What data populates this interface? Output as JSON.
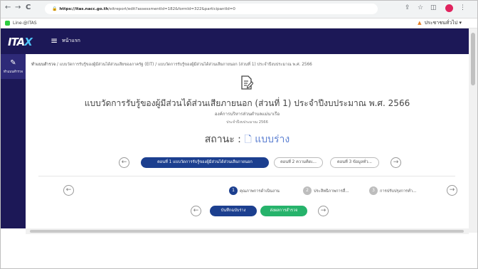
{
  "browser": {
    "url_host": "https://itas.nacc.go.th",
    "url_path": "/eitreport/edit?assessmentId=182&formId=322&participantId=0",
    "nav_back": "←",
    "nav_forward": "→",
    "nav_reload": "C",
    "lock_icon": "🔒",
    "share_icon": "⇪",
    "star_icon": "☆",
    "ext_icon": "◫"
  },
  "bookmark": {
    "label": "Line-@ITAS"
  },
  "user_menu": {
    "label": "ประชาชนทั่วไป ▾",
    "icon": "▲"
  },
  "header": {
    "logo_main": "ITA",
    "logo_accent": "X",
    "menu_icon": "≡",
    "home_label": "หน้าแรก"
  },
  "sidebar": {
    "item_label": "ทำแบบสำรวจ",
    "item_icon": "✎"
  },
  "breadcrumb": {
    "item1": "ทำแบบสำรวจ",
    "sep": "/",
    "item2": "แบบวัดการรับรู้ของผู้มีส่วนได้ส่วนเสียของภาครัฐ (EIT)",
    "item3": "แบบวัดการรับรู้ของผู้มีส่วนได้ส่วนเสียภายนอก (ส่วนที่ 1) ประจำปีงบประมาณ พ.ศ. 2566"
  },
  "form": {
    "title": "แบบวัดการรับรู้ของผู้มีส่วนได้ส่วนเสียภายนอก (ส่วนที่ 1) ประจำปีงบประมาณ พ.ศ. 2566",
    "organization": "องค์การบริหารส่วนตำบลแม่นาเรือ",
    "fiscal_year": "ประจำปีงบประมาณ 2566",
    "status_label": "สถานะ :",
    "status_icon": "🗋",
    "status_value": "แบบร่าง"
  },
  "parts": [
    {
      "label": "ตอนที่ 1 แบบวัดการรับรู้ของผู้มีส่วนได้ส่วนเสียภายนอก",
      "active": true
    },
    {
      "label": "ตอนที่ 2 ความคิดเ...",
      "active": false
    },
    {
      "label": "ตอนที่ 3 ข้อมูลทั่ว...",
      "active": false
    }
  ],
  "steps": [
    {
      "num": "1",
      "label": "คุณภาพการดำเนินงาน",
      "active": true
    },
    {
      "num": "2",
      "label": "ประสิทธิภาพการสื่...",
      "active": false
    },
    {
      "num": "3",
      "label": "การปรับปรุงการทำ...",
      "active": false
    }
  ],
  "icons": {
    "prev": "←",
    "next": "→"
  },
  "actions": {
    "save_draft": "บันทึกฉบับร่าง",
    "submit": "ส่งผลการสำรวจ"
  }
}
